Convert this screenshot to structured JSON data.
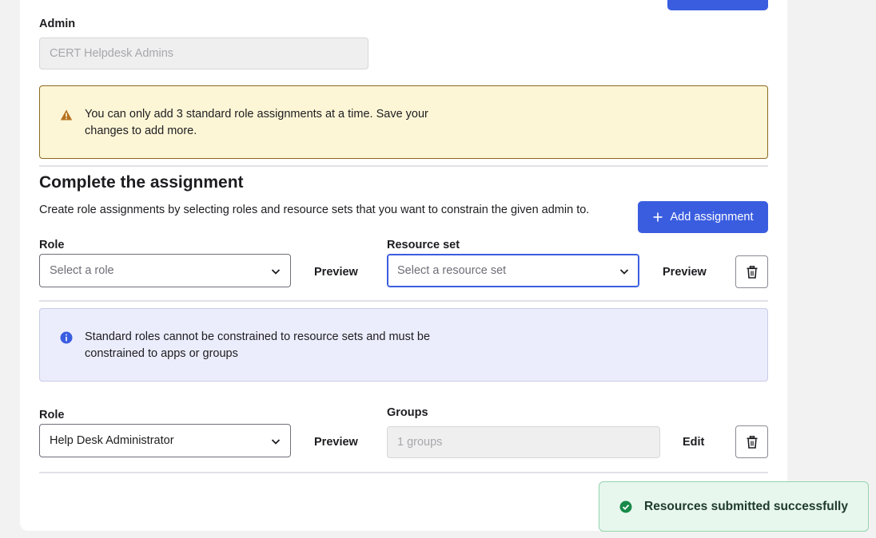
{
  "admin": {
    "label": "Admin",
    "value": "CERT Helpdesk Admins"
  },
  "warning": {
    "text": "You can only add 3 standard role assignments at a time. Save your changes to add more."
  },
  "section": {
    "title": "Complete the assignment",
    "description": "Create role assignments by selecting roles and resource sets that you want to constrain the given admin to.",
    "add_button_label": "Add assignment"
  },
  "assignment1": {
    "role_label": "Role",
    "role_placeholder": "Select a role",
    "preview_role": "Preview",
    "resource_set_label": "Resource set",
    "resource_set_placeholder": "Select a resource set",
    "preview_resource": "Preview"
  },
  "info": {
    "text": "Standard roles cannot be constrained to resource sets and must be constrained to apps or groups"
  },
  "assignment2": {
    "role_label": "Role",
    "role_value": "Help Desk Administrator",
    "preview_role": "Preview",
    "groups_label": "Groups",
    "groups_value": "1 groups",
    "edit_label": "Edit"
  },
  "toast": {
    "message": "Resources submitted successfully"
  },
  "colors": {
    "primary": "#3a5de0",
    "warning_bg": "#fdf6d6",
    "warning_icon": "#b5721f",
    "info_bg": "#ecedfc",
    "info_icon": "#3a5de0",
    "success_bg": "#e7f7ee",
    "success_icon": "#188a4a"
  },
  "icons": {
    "warning": "warning-triangle-icon",
    "info": "info-circle-icon",
    "chevron": "chevron-down-icon",
    "delete": "trash-icon",
    "add": "plus-icon",
    "success": "check-circle-icon"
  }
}
